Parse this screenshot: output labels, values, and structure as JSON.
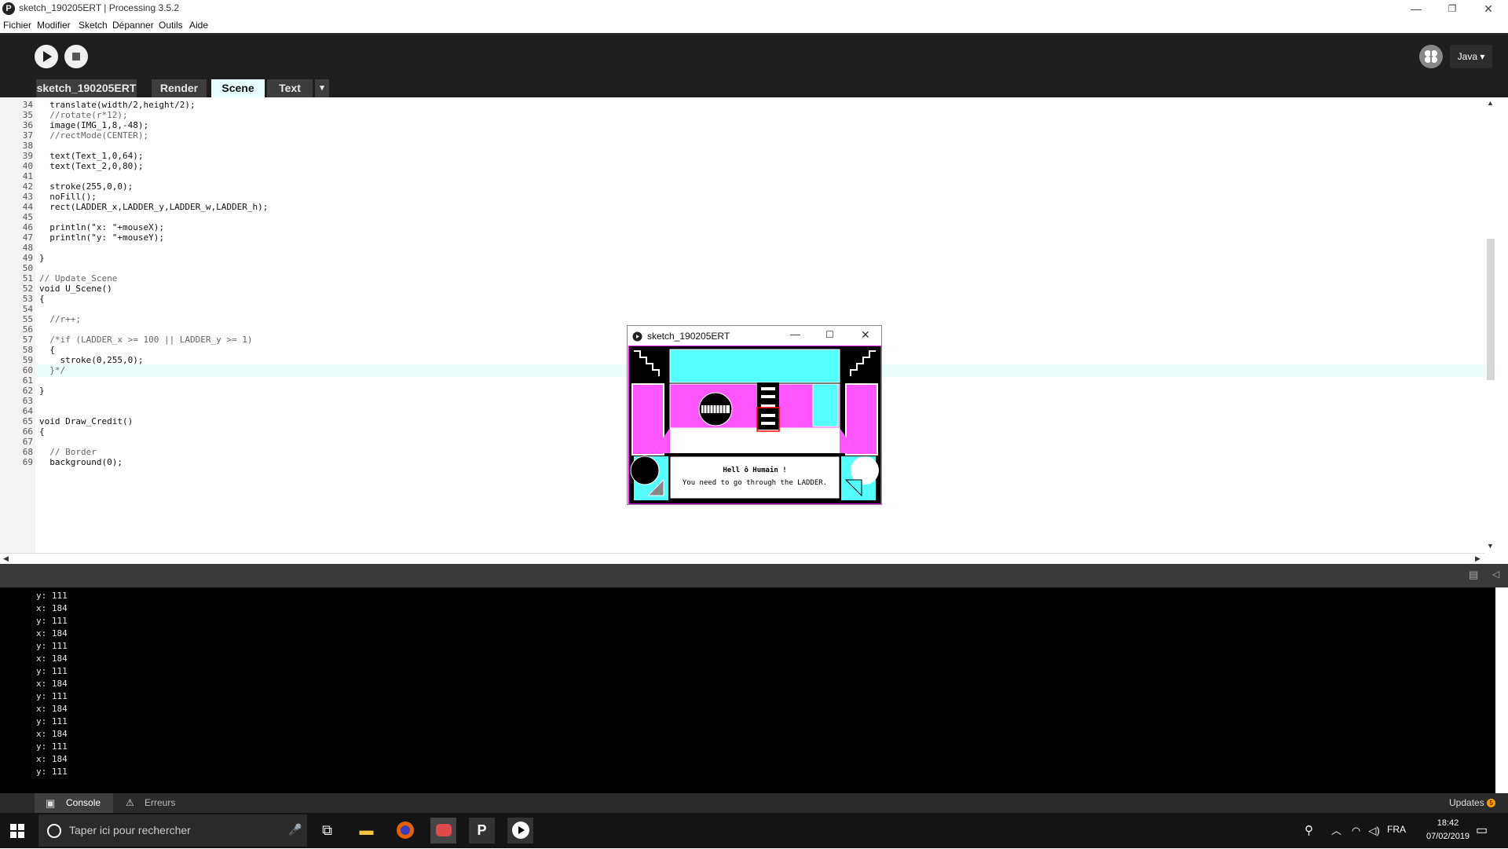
{
  "window": {
    "title": "sketch_190205ERT | Processing 3.5.2",
    "app_icon": "P",
    "minimize": "—",
    "restore": "❐",
    "close": "✕"
  },
  "menu": [
    "Fichier",
    "Modifier",
    "Sketch",
    "Dépanner",
    "Outils",
    "Aide"
  ],
  "toolbar": {
    "run_icon": "play-icon",
    "stop_icon": "stop-icon",
    "debug_icon": "butterfly-icon",
    "mode": "Java ▾"
  },
  "tabs": [
    {
      "label": "sketch_190205ERT"
    },
    {
      "label": "Render"
    },
    {
      "label": "Scene",
      "active": true
    },
    {
      "label": "Text"
    },
    {
      "label": "▾"
    }
  ],
  "editor": {
    "current_line": 60,
    "lines": [
      {
        "n": "34",
        "code": "  translate(width/2,height/2);"
      },
      {
        "n": "35",
        "code": "  //rotate(r*12);"
      },
      {
        "n": "36",
        "code": "  image(IMG_1,8,-48);"
      },
      {
        "n": "37",
        "code": "  //rectMode(CENTER);"
      },
      {
        "n": "38",
        "code": ""
      },
      {
        "n": "39",
        "code": "  text(Text_1,0,64);"
      },
      {
        "n": "40",
        "code": "  text(Text_2,0,80);"
      },
      {
        "n": "41",
        "code": ""
      },
      {
        "n": "42",
        "code": "  stroke(255,0,0);"
      },
      {
        "n": "43",
        "code": "  noFill();"
      },
      {
        "n": "44",
        "code": "  rect(LADDER_x,LADDER_y,LADDER_w,LADDER_h);"
      },
      {
        "n": "45",
        "code": ""
      },
      {
        "n": "46",
        "code": "  println(\"x: \"+mouseX);"
      },
      {
        "n": "47",
        "code": "  println(\"y: \"+mouseY);"
      },
      {
        "n": "48",
        "code": ""
      },
      {
        "n": "49",
        "code": "}"
      },
      {
        "n": "50",
        "code": ""
      },
      {
        "n": "51",
        "code": "// Update_Scene"
      },
      {
        "n": "52",
        "code": "void U_Scene()"
      },
      {
        "n": "53",
        "code": "{"
      },
      {
        "n": "54",
        "code": ""
      },
      {
        "n": "55",
        "code": "  //r++;"
      },
      {
        "n": "56",
        "code": ""
      },
      {
        "n": "57",
        "code": "  /*if (LADDER_x >= 100 || LADDER_y >= 1)"
      },
      {
        "n": "58",
        "code": "  {"
      },
      {
        "n": "59",
        "code": "    stroke(0,255,0);"
      },
      {
        "n": "60",
        "code": "  }*/"
      },
      {
        "n": "61",
        "code": ""
      },
      {
        "n": "62",
        "code": "}"
      },
      {
        "n": "63",
        "code": ""
      },
      {
        "n": "64",
        "code": ""
      },
      {
        "n": "65",
        "code": "void Draw_Credit()"
      },
      {
        "n": "66",
        "code": "{"
      },
      {
        "n": "67",
        "code": ""
      },
      {
        "n": "68",
        "code": "  // Border"
      },
      {
        "n": "69",
        "code": "  background(0);"
      }
    ]
  },
  "console": {
    "lines": [
      "y: 111",
      "x: 184",
      "y: 111",
      "x: 184",
      "y: 111",
      "x: 184",
      "y: 111",
      "x: 184",
      "y: 111",
      "x: 184",
      "y: 111",
      "x: 184",
      "y: 111",
      "x: 184",
      "y: 111"
    ]
  },
  "statusbar": {
    "console_tab": "Console",
    "errors_tab": "Erreurs",
    "updates": "Updates",
    "updates_count": "5"
  },
  "sketch_window": {
    "title": "sketch_190205ERT",
    "message_line1": "Hell ô Humain !",
    "message_line2": "You need to go through the LADDER.",
    "colors": {
      "cyan": "#55ffff",
      "magenta": "#ff55ff",
      "black": "#000000",
      "white": "#ffffff"
    }
  },
  "taskbar": {
    "search_placeholder": "Taper ici pour rechercher",
    "lang": "FRA",
    "time": "18:42",
    "date": "07/02/2019"
  }
}
